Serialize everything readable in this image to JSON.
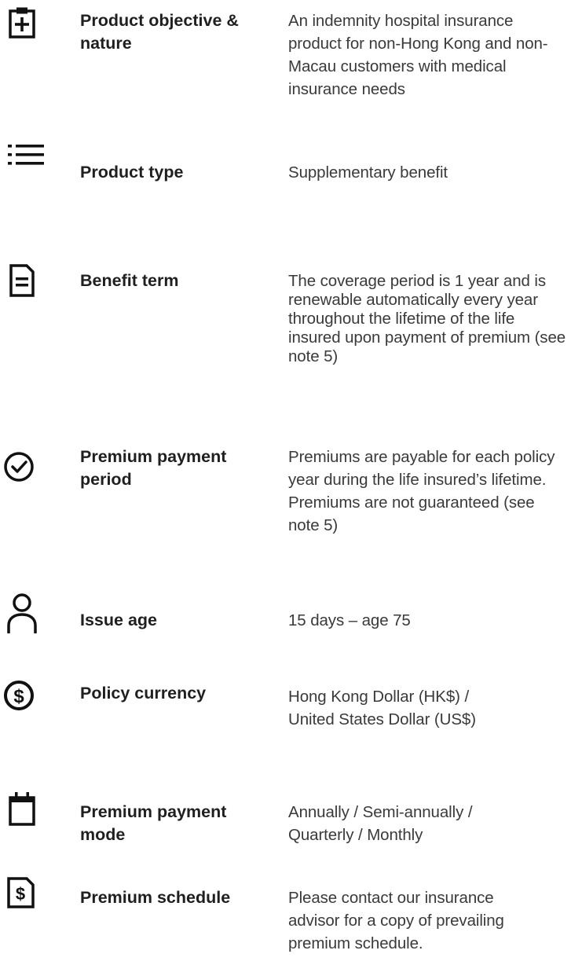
{
  "rows": [
    {
      "icon": "medical-clipboard-icon",
      "label": "Product objective & nature",
      "value": "An indemnity hospital insurance product for non-Hong Kong and non-Macau customers with medical insurance needs"
    },
    {
      "icon": "list-icon",
      "label": "Product type",
      "value": "Supplementary benefit"
    },
    {
      "icon": "document-icon",
      "label": "Benefit term",
      "value": "The coverage period is 1 year and is renewable automatically every year throughout the lifetime of the life insured upon payment of premium (see note 5)"
    },
    {
      "icon": "check-circle-icon",
      "label": "Premium payment period",
      "value": "Premiums are payable for each policy year during the life insured’s lifetime. Premiums are not guaranteed (see note 5)"
    },
    {
      "icon": "person-icon",
      "label": "Issue age",
      "value": "15 days – age 75"
    },
    {
      "icon": "dollar-circle-icon",
      "label": "Policy currency",
      "value": "Hong Kong Dollar (HK$) / United States Dollar (US$)"
    },
    {
      "icon": "calendar-icon",
      "label": "Premium payment mode",
      "value": "Annually / Semi-annually / Quarterly / Monthly"
    },
    {
      "icon": "dollar-document-icon",
      "label": "Premium schedule",
      "value": "Please contact our insurance advisor for a copy of prevailing premium schedule."
    }
  ]
}
